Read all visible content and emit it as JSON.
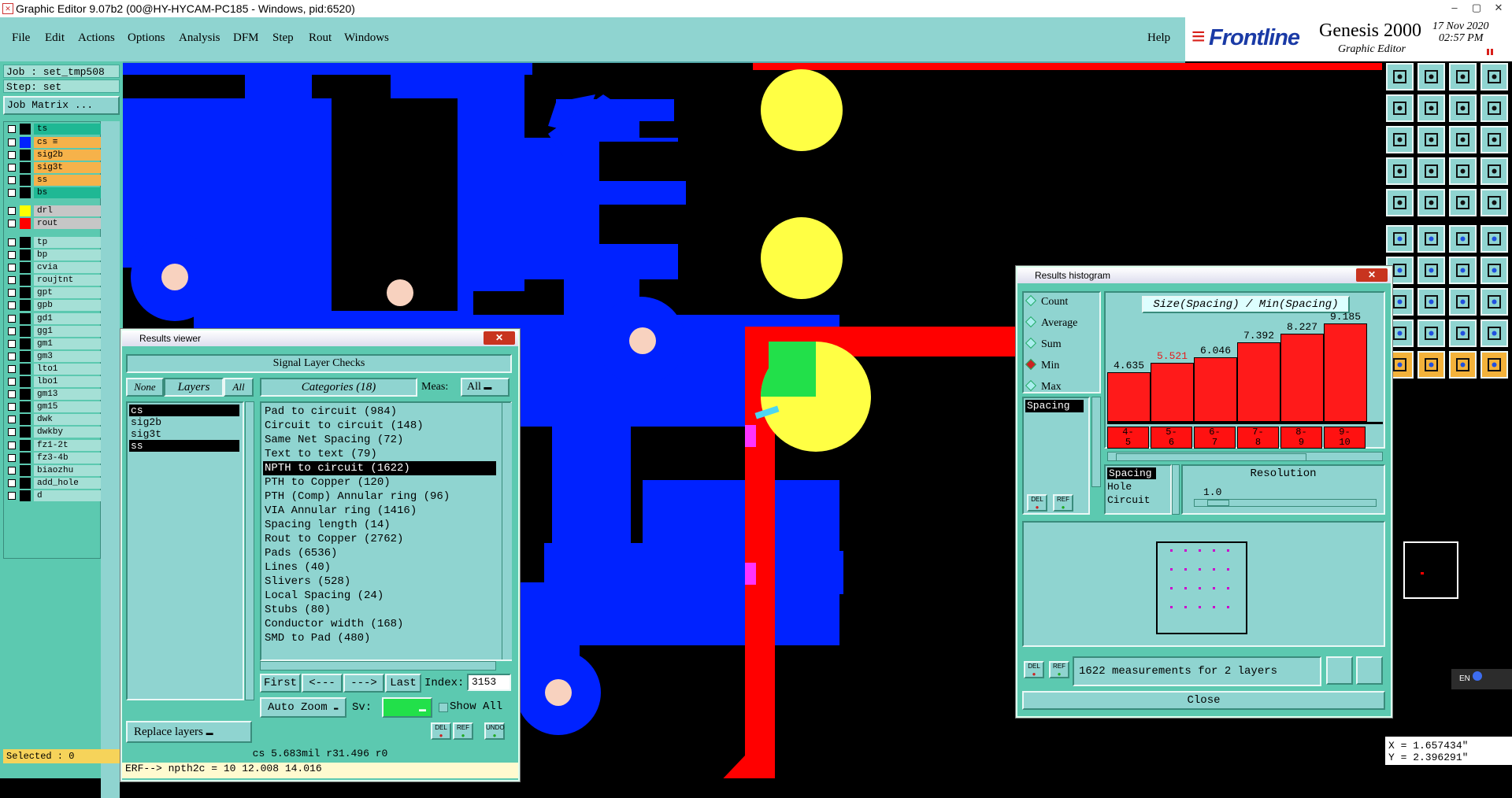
{
  "titlebar": {
    "title": "Graphic Editor 9.07b2 (00@HY-HYCAM-PC185 - Windows, pid:6520)",
    "min": "–",
    "max": "▢",
    "close": "✕"
  },
  "menu": [
    "File",
    "Edit",
    "Actions",
    "Options",
    "Analysis",
    "DFM",
    "Step",
    "Rout",
    "Windows"
  ],
  "help": "Help",
  "brand": {
    "logo": "Frontline",
    "product": "Genesis 2000",
    "sub": "Graphic Editor",
    "date": "17 Nov 2020",
    "time": "02:57 PM"
  },
  "left": {
    "job": "Job : set_tmp508",
    "step": "Step: set",
    "job_matrix": "Job Matrix ...",
    "layers": [
      {
        "name": "ts",
        "color": "#000000",
        "bg": "#1fb894"
      },
      {
        "name": "cs",
        "color": "#0022ff",
        "bg": "#f6b24a",
        "mark": "≡"
      },
      {
        "name": "sig2b",
        "color": "#000000",
        "bg": "#f6b24a"
      },
      {
        "name": "sig3t",
        "color": "#000000",
        "bg": "#f6b24a"
      },
      {
        "name": "ss",
        "color": "#000000",
        "bg": "#f6b24a"
      },
      {
        "name": "bs",
        "color": "#000000",
        "bg": "#1fb894"
      },
      {
        "name": "drl",
        "color": "#ffff00",
        "bg": "#c6c6c6"
      },
      {
        "name": "rout",
        "color": "#ff0000",
        "bg": "#c6c6c6"
      },
      {
        "name": "tp",
        "color": "#000000",
        "bg": "#a5e0d6"
      },
      {
        "name": "bp",
        "color": "#000000",
        "bg": "#a5e0d6"
      },
      {
        "name": "cvia",
        "color": "#000000",
        "bg": "#a5e0d6"
      },
      {
        "name": "roujtnt",
        "color": "#000000",
        "bg": "#a5e0d6"
      },
      {
        "name": "gpt",
        "color": "#000000",
        "bg": "#a5e0d6"
      },
      {
        "name": "gpb",
        "color": "#000000",
        "bg": "#a5e0d6"
      },
      {
        "name": "gd1",
        "color": "#000000",
        "bg": "#a5e0d6"
      },
      {
        "name": "gg1",
        "color": "#000000",
        "bg": "#a5e0d6"
      },
      {
        "name": "gm1",
        "color": "#000000",
        "bg": "#a5e0d6"
      },
      {
        "name": "gm3",
        "color": "#000000",
        "bg": "#a5e0d6"
      },
      {
        "name": "lto1",
        "color": "#000000",
        "bg": "#a5e0d6"
      },
      {
        "name": "lbo1",
        "color": "#000000",
        "bg": "#a5e0d6"
      },
      {
        "name": "gm13",
        "color": "#000000",
        "bg": "#a5e0d6"
      },
      {
        "name": "gm15",
        "color": "#000000",
        "bg": "#a5e0d6"
      },
      {
        "name": "dwk",
        "color": "#000000",
        "bg": "#a5e0d6"
      },
      {
        "name": "dwkby",
        "color": "#000000",
        "bg": "#a5e0d6"
      },
      {
        "name": "fz1-2t",
        "color": "#000000",
        "bg": "#a5e0d6"
      },
      {
        "name": "fz3-4b",
        "color": "#000000",
        "bg": "#a5e0d6"
      },
      {
        "name": "biaozhu",
        "color": "#000000",
        "bg": "#a5e0d6"
      },
      {
        "name": "add_hole",
        "color": "#000000",
        "bg": "#a5e0d6"
      },
      {
        "name": "d",
        "color": "#000000",
        "bg": "#a5e0d6"
      }
    ],
    "selected": "Selected : 0"
  },
  "viewer": {
    "title": "Results viewer",
    "section": "Signal Layer Checks",
    "none": "None",
    "layers_tab": "Layers",
    "all": "All",
    "categories_label": "Categories (18)",
    "meas_label": "Meas:",
    "meas_value": "All",
    "layer_list": [
      "cs",
      "sig2b",
      "sig3t",
      "ss"
    ],
    "categories": [
      "Pad to circuit (984)",
      "Circuit to circuit (148)",
      "Same Net Spacing (72)",
      "Text to text (79)",
      "NPTH to circuit (1622)",
      "PTH to Copper (120)",
      "PTH (Comp) Annular ring (96)",
      "VIA Annular ring (1416)",
      "Spacing length (14)",
      "Rout to Copper (2762)",
      "Pads (6536)",
      "Lines (40)",
      "Slivers (528)",
      "Local Spacing (24)",
      "Stubs (80)",
      "Conductor width (168)",
      "SMD to Pad (480)"
    ],
    "first": "First",
    "prev": "<---",
    "next": "--->",
    "last": "Last",
    "index_label": "Index:",
    "index_value": "3153",
    "auto_zoom": "Auto Zoom",
    "sv": "Sv:",
    "show_all": "Show All",
    "replace": "Replace layers",
    "del": "DEL",
    "ref": "REF",
    "undo": "UNDO",
    "status": "cs 5.683mil  r31.496  r0",
    "erf": "ERF--> npth2c = 10 12.008 14.016"
  },
  "histogram": {
    "title": "Results histogram",
    "modes": [
      "Count",
      "Average",
      "Sum",
      "Min",
      "Max"
    ],
    "selected_mode": "Min",
    "measure_list": [
      "Spacing"
    ],
    "chart_title": "Size(Spacing) / Min(Spacing)",
    "meas_types": [
      "Spacing",
      "Hole",
      "Circuit"
    ],
    "resolution_label": "Resolution",
    "resolution_value": "1.0",
    "summary": "1622 measurements for 2 layers",
    "close": "Close",
    "del": "DEL",
    "ref": "REF"
  },
  "chart_data": {
    "type": "bar",
    "title": "Size(Spacing) / Min(Spacing)",
    "categories": [
      "4-5",
      "5-6",
      "6-7",
      "7-8",
      "8-9",
      "9-10"
    ],
    "values": [
      4.635,
      5.521,
      6.046,
      7.392,
      8.227,
      9.185
    ],
    "highlight_index": 1,
    "highlight_color": "#e61c1c",
    "bar_color": "#ff1a1a",
    "ylim": [
      0,
      10
    ]
  },
  "coords": {
    "x": "X = 1.657434\"",
    "y": "Y = 2.396291\""
  },
  "taskbar": {
    "lang": "EN"
  },
  "colors": {
    "panel": "#5cc9b0",
    "menu": "#8fd4d0",
    "canvas_bg": "#000000",
    "copper": "#0022ff",
    "drill": "#ffff44",
    "rout": "#ff0000"
  }
}
